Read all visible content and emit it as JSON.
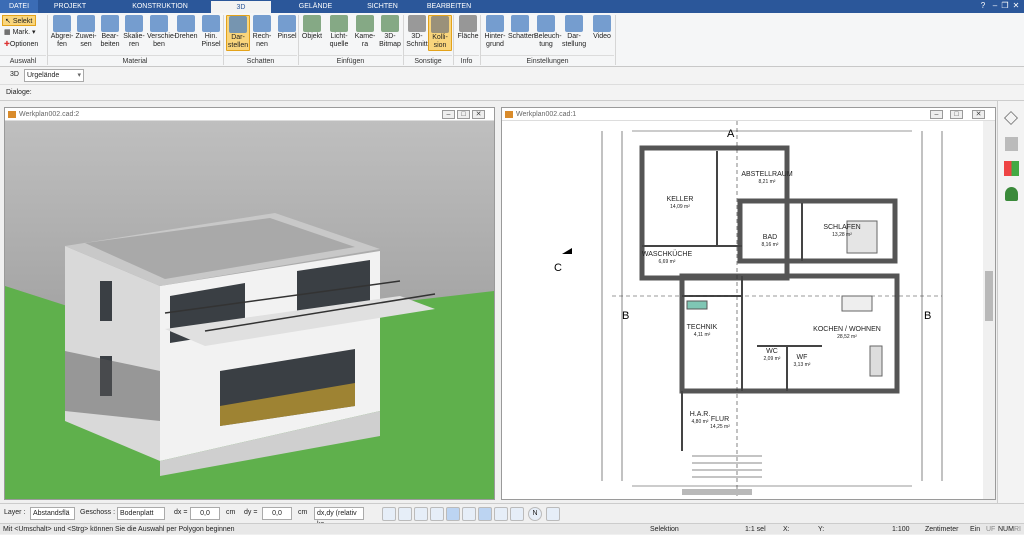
{
  "tabs": [
    "DATEI",
    "PROJEKT",
    "KONSTRUKTION",
    "3D",
    "GELÄNDE",
    "SICHTEN",
    "BEARBEITEN"
  ],
  "ribbon": {
    "auswahl": {
      "selekt": "Selekt",
      "mark": "Mark.",
      "optionen": "Optionen",
      "group": "Auswahl"
    },
    "material": {
      "buttons": [
        [
          "Abgrei-",
          "fen"
        ],
        [
          "Zuwei-",
          "sen"
        ],
        [
          "Bear-",
          "beiten"
        ],
        [
          "Skalie-",
          "ren"
        ],
        [
          "Verschie-",
          "ben"
        ],
        [
          "Drehen",
          ""
        ],
        [
          "Hin.",
          "Pinsel"
        ]
      ],
      "group": "Material"
    },
    "schatten": {
      "buttons": [
        [
          "Dar-",
          "stellen"
        ],
        [
          "Rech-",
          "nen"
        ],
        [
          "Pinsel",
          ""
        ]
      ],
      "group": "Schatten"
    },
    "einfuegen": {
      "buttons": [
        [
          "Objekt",
          ""
        ],
        [
          "Licht-",
          "quelle"
        ],
        [
          "Kame-",
          "ra"
        ],
        [
          "3D-",
          "Bitmap"
        ]
      ],
      "group": "Einfügen"
    },
    "sonstige": {
      "buttons": [
        [
          "3D-",
          "Schnitt"
        ],
        [
          "Kolli-",
          "sion"
        ]
      ],
      "group": "Sonstige"
    },
    "info": {
      "buttons": [
        [
          "Fläche",
          ""
        ]
      ],
      "group": "Info"
    },
    "einstellungen": {
      "buttons": [
        [
          "Hinter-",
          "grund"
        ],
        [
          "Schatten",
          ""
        ],
        [
          "Beleuch-",
          "tung"
        ],
        [
          "Dar-",
          "stellung"
        ],
        [
          "Video",
          ""
        ]
      ],
      "group": "Einstellungen"
    }
  },
  "viewbar": {
    "mode": "3D",
    "terrain": "Urgelände"
  },
  "dialogbar": {
    "label": "Dialoge:"
  },
  "window3d": {
    "title": "Werkplan002.cad:2"
  },
  "windowplan": {
    "title": "Werkplan002.cad:1"
  },
  "plan": {
    "rooms": [
      {
        "name": "KELLER",
        "area": "14,09 m²"
      },
      {
        "name": "ABSTELLRAUM",
        "area": "8,21 m²"
      },
      {
        "name": "WASCHKÜCHE",
        "area": "6,69 m²"
      },
      {
        "name": "BAD",
        "area": "8,16 m²"
      },
      {
        "name": "SCHLAFEN",
        "area": "13,28 m²"
      },
      {
        "name": "TECHNIK",
        "area": "4,11 m²"
      },
      {
        "name": "KOCHEN / WOHNEN",
        "area": "28,52 m²"
      },
      {
        "name": "WC",
        "area": "2,09 m²"
      },
      {
        "name": "WF",
        "area": "3,13 m²"
      },
      {
        "name": "H.A.R.",
        "area": "4,80 m²"
      },
      {
        "name": "FLUR",
        "area": "14,25 m²"
      }
    ],
    "section_labels": [
      "A",
      "B",
      "B",
      "C"
    ]
  },
  "bottombar": {
    "layer_label": "Layer :",
    "layer_value": "Abstandsflä",
    "geschoss_label": "Geschoss :",
    "geschoss_value": "Bodenplatt",
    "dx_label": "dx =",
    "dx_value": "0,0",
    "dx_unit": "cm",
    "dy_label": "dy =",
    "dy_value": "0,0",
    "dy_unit": "cm",
    "mode_value": "dx,dy (relativ ka"
  },
  "status": {
    "hint": "Mit <Umschalt> und <Strg> können Sie die Auswahl per Polygon beginnen",
    "selektion": "Selektion",
    "sel": "1:1 sel",
    "x": "X:",
    "y": "Y:",
    "scale": "1:100",
    "unit": "Zentimeter",
    "ein": "Ein",
    "uf": "UF",
    "num": "NUM",
    "ri": "RI"
  },
  "colors": {
    "accent": "#2b579a",
    "active": "#f9d57c",
    "grass": "#5fb04c"
  }
}
